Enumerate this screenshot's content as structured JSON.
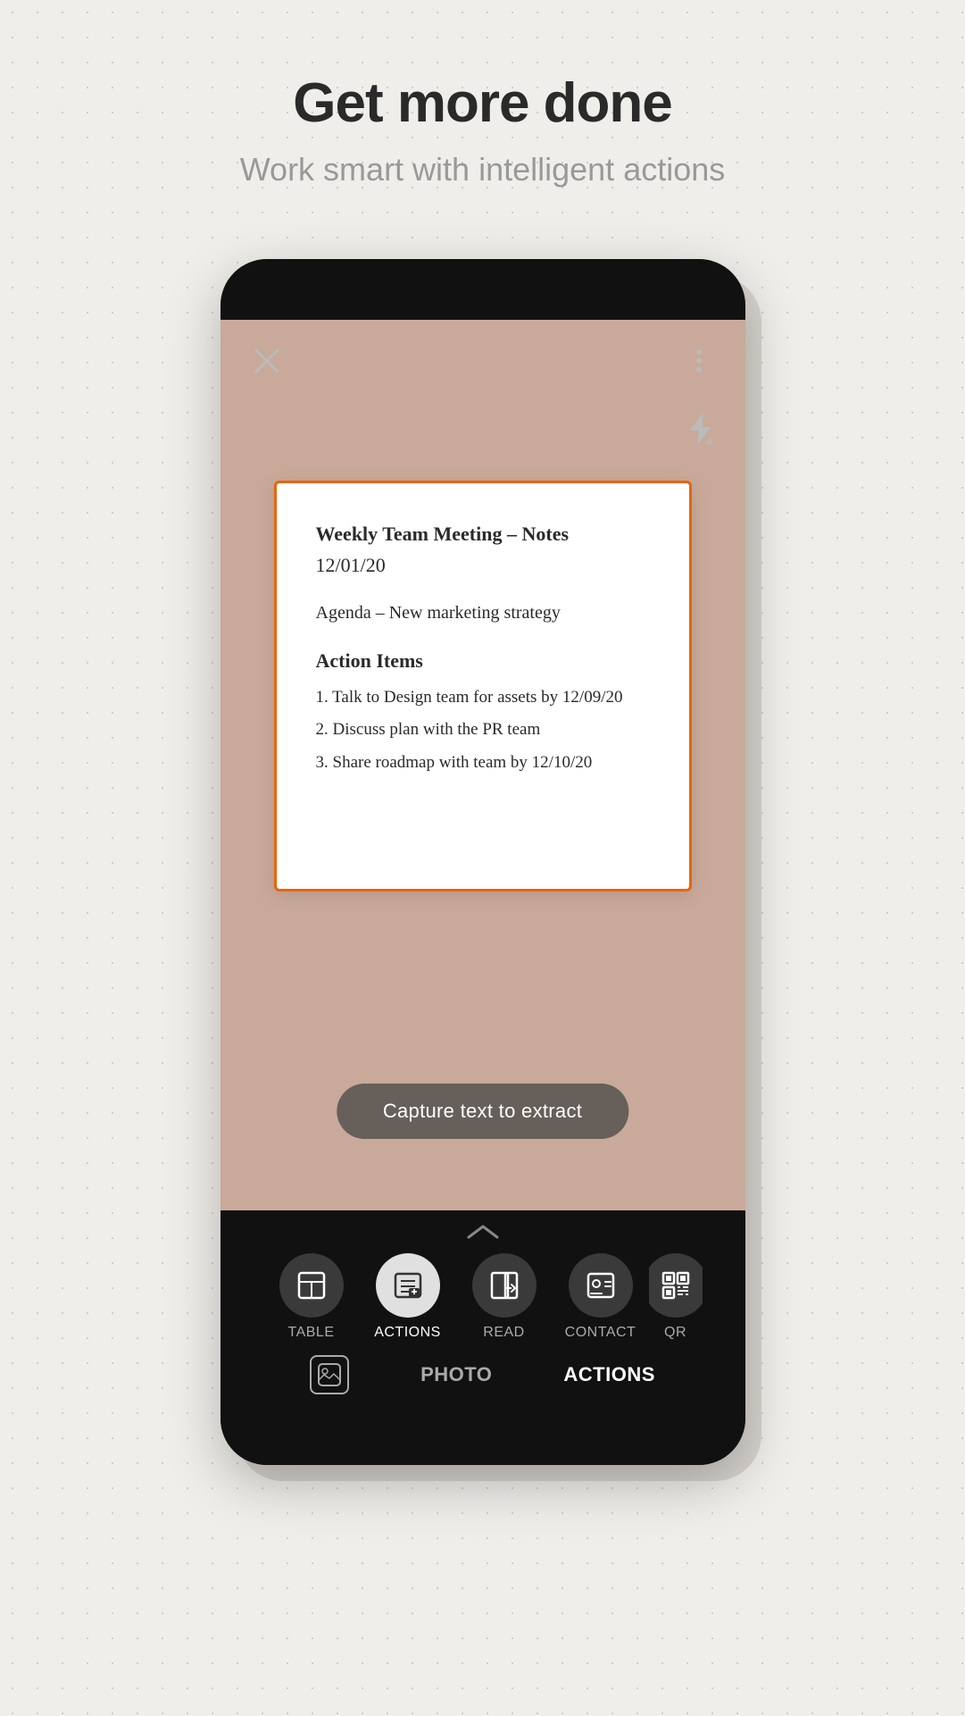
{
  "page": {
    "background_color": "#f0eeea"
  },
  "header": {
    "title": "Get more done",
    "subtitle": "Work smart with intelligent actions"
  },
  "phone": {
    "document": {
      "title": "Weekly Team Meeting – Notes",
      "date": "12/01/20",
      "agenda": "Agenda – New marketing strategy",
      "action_items_title": "Action Items",
      "items": [
        "1. Talk to Design team for assets by 12/09/20",
        "2. Discuss plan with the PR team",
        "3. Share roadmap with team by 12/10/20"
      ]
    },
    "capture_button_label": "Capture text to extract",
    "modes": [
      {
        "id": "table",
        "label": "TABLE",
        "active": false
      },
      {
        "id": "actions",
        "label": "ACTIONS",
        "active": true
      },
      {
        "id": "read",
        "label": "READ",
        "active": false
      },
      {
        "id": "contact",
        "label": "CONTACT",
        "active": false
      },
      {
        "id": "qr",
        "label": "QR",
        "active": false
      }
    ],
    "tabs": [
      {
        "id": "photo",
        "label": "PHOTO",
        "active": false
      },
      {
        "id": "actions",
        "label": "ACTIONS",
        "active": true
      }
    ]
  }
}
